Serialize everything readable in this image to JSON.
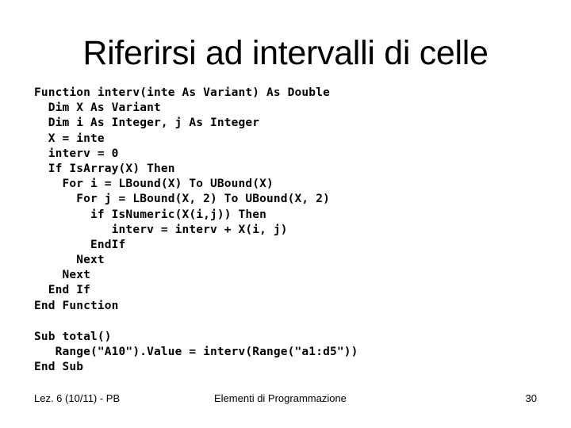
{
  "slide": {
    "title": "Riferirsi ad intervalli di celle",
    "code_function": [
      "Function interv(inte As Variant) As Double",
      "  Dim X As Variant",
      "  Dim i As Integer, j As Integer",
      "  X = inte",
      "  interv = 0",
      "  If IsArray(X) Then",
      "    For i = LBound(X) To UBound(X)",
      "      For j = LBound(X, 2) To UBound(X, 2)",
      "        if IsNumeric(X(i,j)) Then",
      "           interv = interv + X(i, j)",
      "        EndIf",
      "      Next",
      "    Next",
      "  End If",
      "End Function"
    ],
    "code_sub": [
      "Sub total()",
      "   Range(\"A10\").Value = interv(Range(\"a1:d5\"))",
      "End Sub"
    ]
  },
  "footer": {
    "left": "Lez. 6 (10/11) - PB",
    "center": "Elementi di Programmazione",
    "page_number": "30"
  }
}
